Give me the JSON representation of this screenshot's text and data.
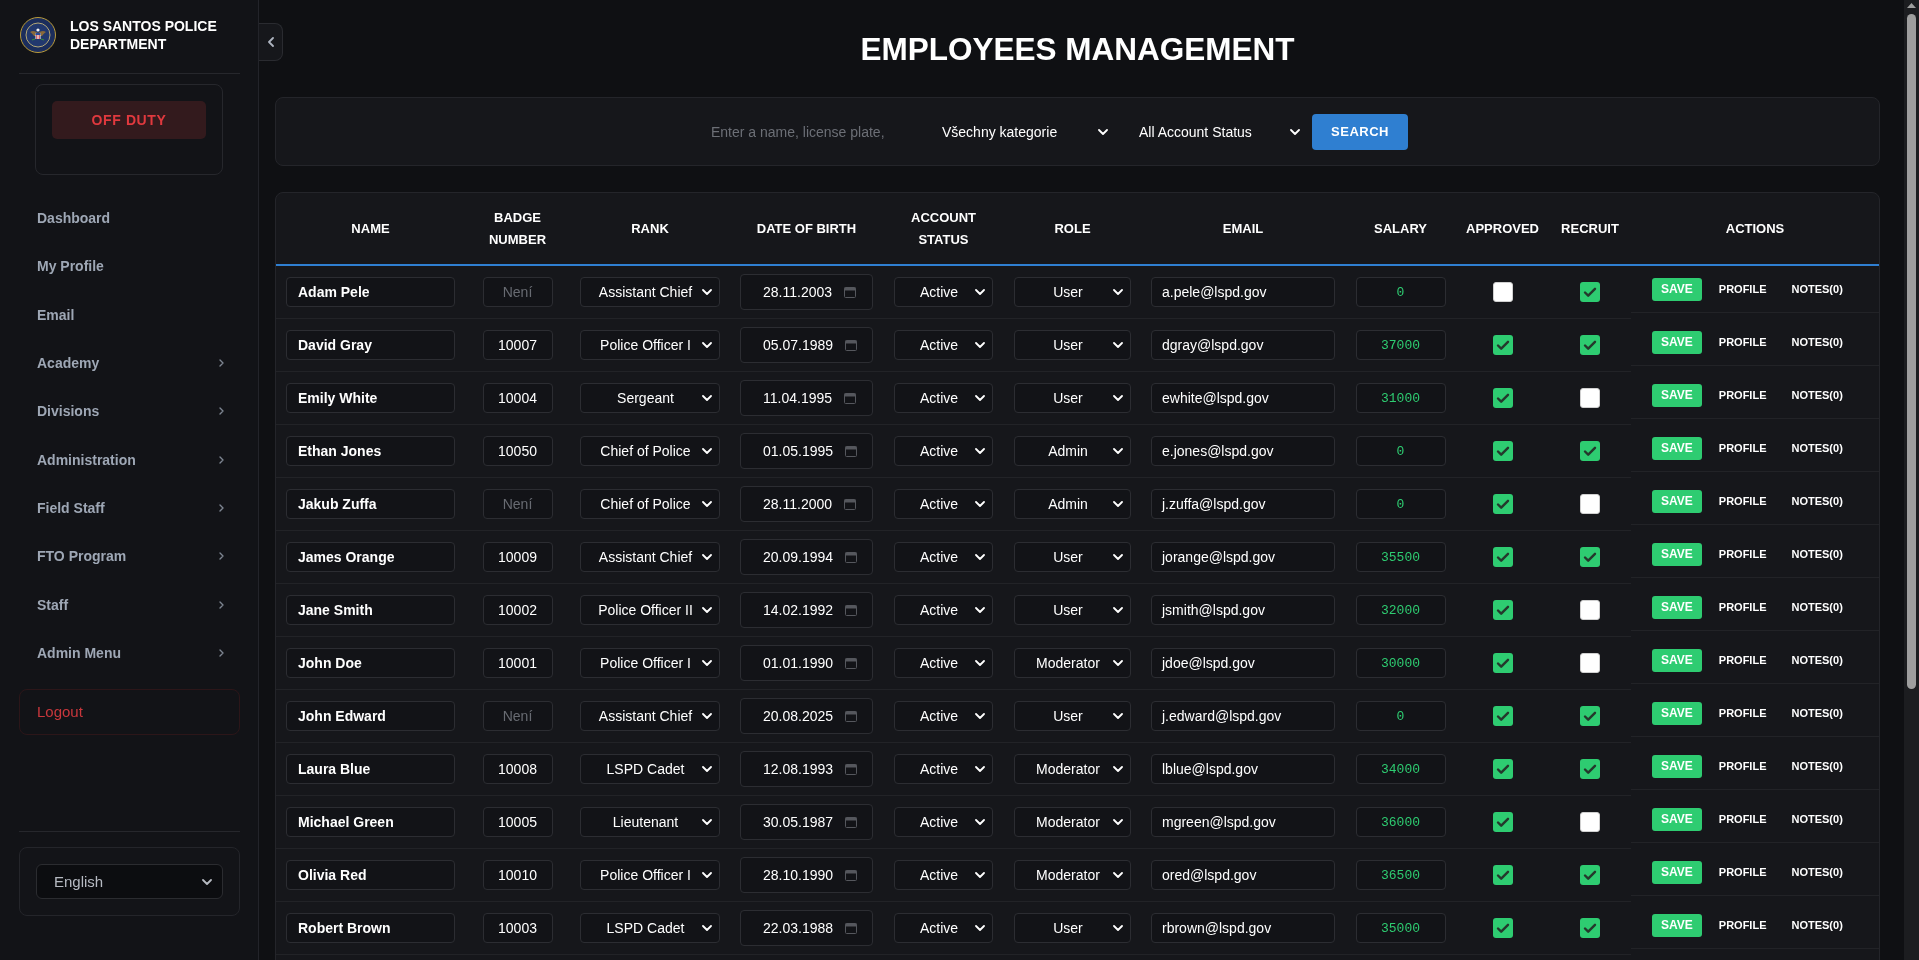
{
  "sidebar": {
    "title": "LOS SANTOS POLICE DEPARTMENT",
    "duty_button": "OFF DUTY",
    "items": [
      {
        "label": "Dashboard",
        "has_submenu": false
      },
      {
        "label": "My Profile",
        "has_submenu": false
      },
      {
        "label": "Email",
        "has_submenu": false
      },
      {
        "label": "Academy",
        "has_submenu": true
      },
      {
        "label": "Divisions",
        "has_submenu": true
      },
      {
        "label": "Administration",
        "has_submenu": true
      },
      {
        "label": "Field Staff",
        "has_submenu": true
      },
      {
        "label": "FTO Program",
        "has_submenu": true
      },
      {
        "label": "Staff",
        "has_submenu": true
      },
      {
        "label": "Admin Menu",
        "has_submenu": true
      }
    ],
    "logout": "Logout",
    "language": "English"
  },
  "page_title": "EMPLOYEES MANAGEMENT",
  "search": {
    "placeholder": "Enter a name, license plate,",
    "category": "Všechny kategorie",
    "account_status": "All Account Status",
    "button": "SEARCH"
  },
  "table": {
    "columns": [
      "NAME",
      "BADGE NUMBER",
      "RANK",
      "DATE OF BIRTH",
      "ACCOUNT STATUS",
      "ROLE",
      "EMAIL",
      "SALARY",
      "APPROVED",
      "RECRUIT",
      "ACTIONS"
    ],
    "rows": [
      {
        "name": "Adam Pele",
        "badge": {
          "placeholder": "Není"
        },
        "rank": "Assistant Chief",
        "date_of_birth": "28.11.2003",
        "account_status": "Active",
        "role": "User",
        "email": "a.pele@lspd.gov",
        "salary": "0",
        "approved": false,
        "recruit": true,
        "actions": [
          {
            "kind": "save",
            "label": "SAVE"
          },
          {
            "kind": "profile",
            "label": "PROFILE"
          },
          {
            "kind": "notes",
            "label": "NOTES(0)"
          }
        ]
      },
      {
        "name": "David Gray",
        "badge": {
          "value": "10007"
        },
        "rank": "Police Officer I",
        "date_of_birth": "05.07.1989",
        "account_status": "Active",
        "role": "User",
        "email": "dgray@lspd.gov",
        "salary": "37000",
        "approved": true,
        "recruit": true,
        "actions": [
          {
            "kind": "save",
            "label": "SAVE"
          },
          {
            "kind": "profile",
            "label": "PROFILE"
          },
          {
            "kind": "notes",
            "label": "NOTES(0)"
          }
        ]
      },
      {
        "name": "Emily White",
        "badge": {
          "value": "10004"
        },
        "rank": "Sergeant",
        "date_of_birth": "11.04.1995",
        "account_status": "Active",
        "role": "User",
        "email": "ewhite@lspd.gov",
        "salary": "31000",
        "approved": true,
        "recruit": false,
        "actions": [
          {
            "kind": "save",
            "label": "SAVE"
          },
          {
            "kind": "profile",
            "label": "PROFILE"
          },
          {
            "kind": "notes",
            "label": "NOTES(0)"
          }
        ]
      },
      {
        "name": "Ethan Jones",
        "badge": {
          "value": "10050"
        },
        "rank": "Chief of Police",
        "date_of_birth": "01.05.1995",
        "account_status": "Active",
        "role": "Admin",
        "email": "e.jones@lspd.gov",
        "salary": "0",
        "approved": true,
        "recruit": true,
        "actions": [
          {
            "kind": "save",
            "label": "SAVE"
          },
          {
            "kind": "profile",
            "label": "PROFILE"
          },
          {
            "kind": "notes",
            "label": "NOTES(0)"
          }
        ]
      },
      {
        "name": "Jakub Zuffa",
        "badge": {
          "placeholder": "Není"
        },
        "rank": "Chief of Police",
        "date_of_birth": "28.11.2000",
        "account_status": "Active",
        "role": "Admin",
        "email": "j.zuffa@lspd.gov",
        "salary": "0",
        "approved": true,
        "recruit": false,
        "actions": [
          {
            "kind": "save",
            "label": "SAVE"
          },
          {
            "kind": "profile",
            "label": "PROFILE"
          },
          {
            "kind": "notes",
            "label": "NOTES(0)"
          }
        ]
      },
      {
        "name": "James Orange",
        "badge": {
          "value": "10009"
        },
        "rank": "Assistant Chief",
        "date_of_birth": "20.09.1994",
        "account_status": "Active",
        "role": "User",
        "email": "jorange@lspd.gov",
        "salary": "35500",
        "approved": true,
        "recruit": true,
        "actions": [
          {
            "kind": "save",
            "label": "SAVE"
          },
          {
            "kind": "profile",
            "label": "PROFILE"
          },
          {
            "kind": "notes",
            "label": "NOTES(0)"
          }
        ]
      },
      {
        "name": "Jane Smith",
        "badge": {
          "value": "10002"
        },
        "rank": "Police Officer II",
        "date_of_birth": "14.02.1992",
        "account_status": "Active",
        "role": "User",
        "email": "jsmith@lspd.gov",
        "salary": "32000",
        "approved": true,
        "recruit": false,
        "actions": [
          {
            "kind": "save",
            "label": "SAVE"
          },
          {
            "kind": "profile",
            "label": "PROFILE"
          },
          {
            "kind": "notes",
            "label": "NOTES(0)"
          }
        ]
      },
      {
        "name": "John Doe",
        "badge": {
          "value": "10001"
        },
        "rank": "Police Officer I",
        "date_of_birth": "01.01.1990",
        "account_status": "Active",
        "role": "Moderator",
        "email": "jdoe@lspd.gov",
        "salary": "30000",
        "approved": true,
        "recruit": false,
        "actions": [
          {
            "kind": "save",
            "label": "SAVE"
          },
          {
            "kind": "profile",
            "label": "PROFILE"
          },
          {
            "kind": "notes",
            "label": "NOTES(0)"
          }
        ]
      },
      {
        "name": "John Edward",
        "badge": {
          "placeholder": "Není"
        },
        "rank": "Assistant Chief",
        "date_of_birth": "20.08.2025",
        "account_status": "Active",
        "role": "User",
        "email": "j.edward@lspd.gov",
        "salary": "0",
        "approved": true,
        "recruit": true,
        "actions": [
          {
            "kind": "save",
            "label": "SAVE"
          },
          {
            "kind": "profile",
            "label": "PROFILE"
          },
          {
            "kind": "notes",
            "label": "NOTES(0)"
          }
        ]
      },
      {
        "name": "Laura Blue",
        "badge": {
          "value": "10008"
        },
        "rank": "LSPD Cadet",
        "date_of_birth": "12.08.1993",
        "account_status": "Active",
        "role": "Moderator",
        "email": "lblue@lspd.gov",
        "salary": "34000",
        "approved": true,
        "recruit": true,
        "actions": [
          {
            "kind": "save",
            "label": "SAVE"
          },
          {
            "kind": "profile",
            "label": "PROFILE"
          },
          {
            "kind": "notes",
            "label": "NOTES(0)"
          }
        ]
      },
      {
        "name": "Michael Green",
        "badge": {
          "value": "10005"
        },
        "rank": "Lieutenant",
        "date_of_birth": "30.05.1987",
        "account_status": "Active",
        "role": "Moderator",
        "email": "mgreen@lspd.gov",
        "salary": "36000",
        "approved": true,
        "recruit": false,
        "actions": [
          {
            "kind": "save",
            "label": "SAVE"
          },
          {
            "kind": "profile",
            "label": "PROFILE"
          },
          {
            "kind": "notes",
            "label": "NOTES(0)"
          }
        ]
      },
      {
        "name": "Olivia Red",
        "badge": {
          "value": "10010"
        },
        "rank": "Police Officer I",
        "date_of_birth": "28.10.1990",
        "account_status": "Active",
        "role": "Moderator",
        "email": "ored@lspd.gov",
        "salary": "36500",
        "approved": true,
        "recruit": true,
        "actions": [
          {
            "kind": "save",
            "label": "SAVE"
          },
          {
            "kind": "profile",
            "label": "PROFILE"
          },
          {
            "kind": "notes",
            "label": "NOTES(0)"
          }
        ]
      },
      {
        "name": "Robert Brown",
        "badge": {
          "value": "10003"
        },
        "rank": "LSPD Cadet",
        "date_of_birth": "22.03.1988",
        "account_status": "Active",
        "role": "User",
        "email": "rbrown@lspd.gov",
        "salary": "35000",
        "approved": true,
        "recruit": true,
        "actions": [
          {
            "kind": "save",
            "label": "SAVE"
          },
          {
            "kind": "profile",
            "label": "PROFILE"
          },
          {
            "kind": "notes",
            "label": "NOTES(0)"
          }
        ]
      }
    ]
  }
}
